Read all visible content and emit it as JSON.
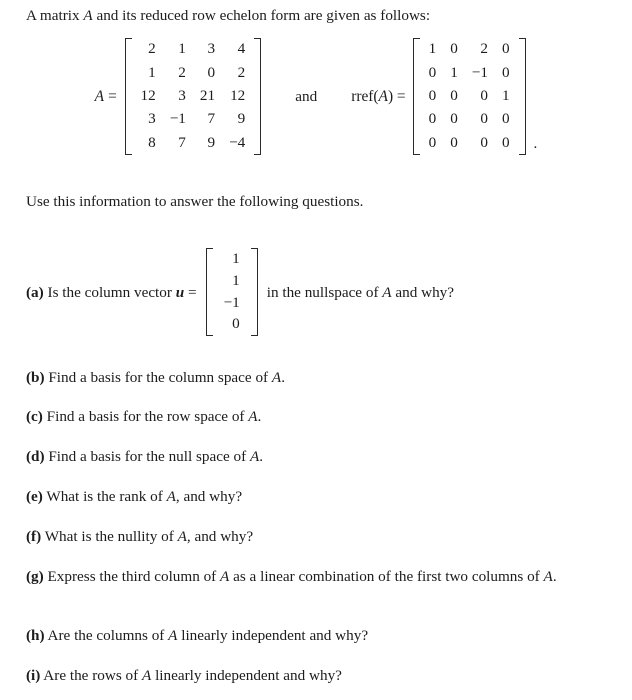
{
  "document": {
    "intro": "A matrix A and its reduced row echelon form are given as follows:",
    "intro_parts": {
      "before": "A matrix ",
      "symbol": "A",
      "after": " and its reduced row echelon form are given as follows:"
    },
    "instruction": "Use this information to answer the following questions.",
    "conjunction": "and",
    "trailing_punctuation": "."
  },
  "matrices": {
    "A": {
      "label_symbol": "A",
      "label_equals": "=",
      "rows": 5,
      "cols": 4,
      "values": [
        [
          "2",
          "1",
          "3",
          "4"
        ],
        [
          "1",
          "2",
          "0",
          "2"
        ],
        [
          "12",
          "3",
          "21",
          "12"
        ],
        [
          "3",
          "−1",
          "7",
          "9"
        ],
        [
          "8",
          "7",
          "9",
          "−4"
        ]
      ]
    },
    "rref_A": {
      "label_prefix": "rref(",
      "label_symbol": "A",
      "label_suffix": ") =",
      "rows": 5,
      "cols": 4,
      "values": [
        [
          "1",
          "0",
          "2",
          "0"
        ],
        [
          "0",
          "1",
          "−1",
          "0"
        ],
        [
          "0",
          "0",
          "0",
          "1"
        ],
        [
          "0",
          "0",
          "0",
          "0"
        ],
        [
          "0",
          "0",
          "0",
          "0"
        ]
      ]
    },
    "u": {
      "label_symbol": "u",
      "label_equals": "=",
      "rows": 4,
      "cols": 1,
      "values": [
        [
          "1"
        ],
        [
          "1"
        ],
        [
          "−1"
        ],
        [
          "0"
        ]
      ]
    }
  },
  "questions": [
    {
      "label": "(a)",
      "text_before_vector": "Is the column vector ",
      "vector_symbol": "u",
      "vector_equals": "=",
      "text_after_vector": " in the nullspace of ",
      "matrix_symbol": "A",
      "text_tail": " and why?",
      "has_vector": true
    },
    {
      "label": "(b)",
      "text_before": " Find a basis for the column space of ",
      "matrix_symbol": "A",
      "text_after": ".",
      "has_vector": false
    },
    {
      "label": "(c)",
      "text_before": " Find a basis for the row space of ",
      "matrix_symbol": "A",
      "text_after": ".",
      "has_vector": false
    },
    {
      "label": "(d)",
      "text_before": " Find a basis for the null space of ",
      "matrix_symbol": "A",
      "text_after": ".",
      "has_vector": false
    },
    {
      "label": "(e)",
      "text_before": " What is the rank of ",
      "matrix_symbol": "A",
      "text_after": ", and why?",
      "has_vector": false
    },
    {
      "label": "(f)",
      "text_before": " What is the nullity of ",
      "matrix_symbol": "A",
      "text_after": ", and why?",
      "has_vector": false
    },
    {
      "label": "(g)",
      "text_before": " Express the third column of ",
      "matrix_symbol": "A",
      "text_after": " as a linear combination of the first two columns of ",
      "matrix_symbol2": "A",
      "text_tail": ".",
      "has_vector": false,
      "justified": true
    },
    {
      "label": "(h)",
      "text_before": " Are the columns of ",
      "matrix_symbol": "A",
      "text_after": " linearly independent and why?",
      "has_vector": false
    },
    {
      "label": "(i)",
      "text_before": " Are the rows of ",
      "matrix_symbol": "A",
      "text_after": " linearly independent and why?",
      "has_vector": false
    }
  ],
  "style": {
    "background_color": "#ffffff",
    "text_color": "#1c1c1c",
    "rule_color": "#2a2a2a"
  }
}
